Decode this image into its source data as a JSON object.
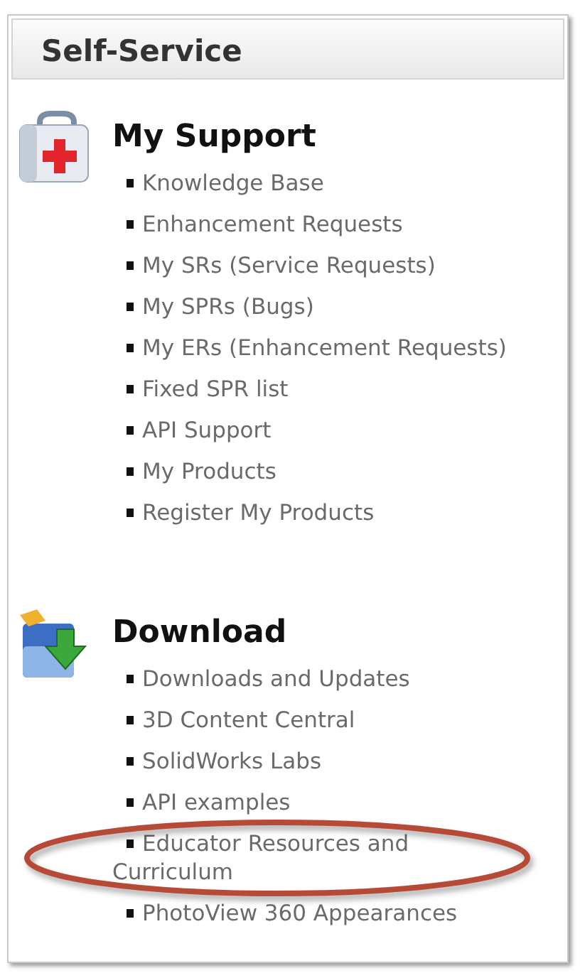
{
  "panel_title": "Self-Service",
  "sections": [
    {
      "kind": "support",
      "title": "My Support",
      "links": [
        {
          "label": "Knowledge Base",
          "circled": false
        },
        {
          "label": "Enhancement Requests",
          "circled": false
        },
        {
          "label": "My SRs (Service Requests)",
          "circled": false
        },
        {
          "label": "My SPRs (Bugs)",
          "circled": false
        },
        {
          "label": "My ERs (Enhancement Requests)",
          "circled": false
        },
        {
          "label": "Fixed SPR list",
          "circled": false
        },
        {
          "label": "API Support",
          "circled": false
        },
        {
          "label": "My Products",
          "circled": false
        },
        {
          "label": "Register My Products",
          "circled": false
        }
      ]
    },
    {
      "kind": "download",
      "title": "Download",
      "links": [
        {
          "label": "Downloads and Updates",
          "circled": false
        },
        {
          "label": "3D Content Central",
          "circled": false
        },
        {
          "label": "SolidWorks Labs",
          "circled": false
        },
        {
          "label": "API examples",
          "circled": false
        },
        {
          "label": "Educator Resources and Curriculum",
          "circled": true
        },
        {
          "label": "PhotoView 360 Appearances",
          "circled": false
        }
      ]
    }
  ]
}
